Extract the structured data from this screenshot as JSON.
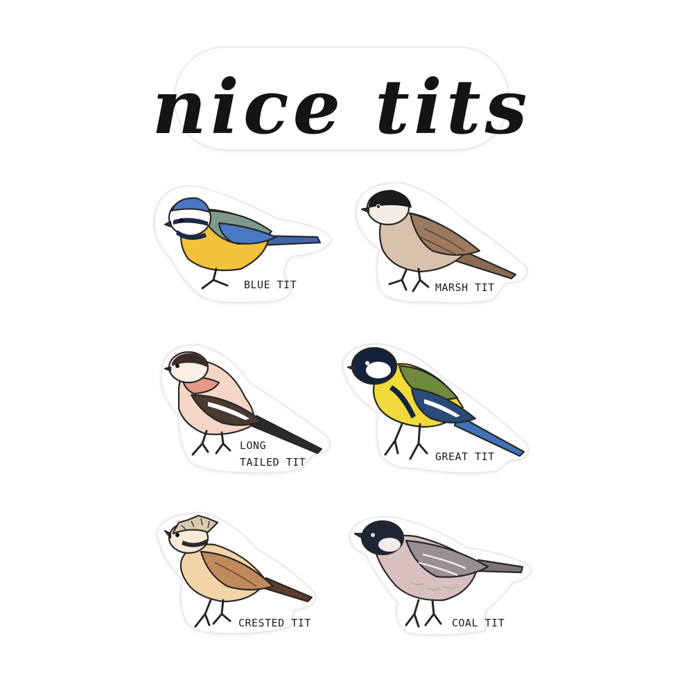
{
  "title": "nice tits",
  "birds": [
    {
      "label_lines": [
        "BLUE TIT"
      ]
    },
    {
      "label_lines": [
        "MARSH TIT"
      ]
    },
    {
      "label_lines": [
        "LONG",
        "TAILED TIT"
      ]
    },
    {
      "label_lines": [
        "GREAT TIT"
      ]
    },
    {
      "label_lines": [
        "CRESTED TIT"
      ]
    },
    {
      "label_lines": [
        "COAL TIT"
      ]
    }
  ],
  "colors": {
    "blue_tit_cap": "#4a78c4",
    "blue_tit_breast": "#f2c23a",
    "great_tit_back": "#6f8a3a",
    "great_tit_breast": "#f0da3c",
    "marsh_tit_back": "#9b7a5f",
    "long_tailed_pink": "#e59a86",
    "crested_tit_back": "#c08a5c",
    "coal_tit_back": "#9a8f95"
  }
}
